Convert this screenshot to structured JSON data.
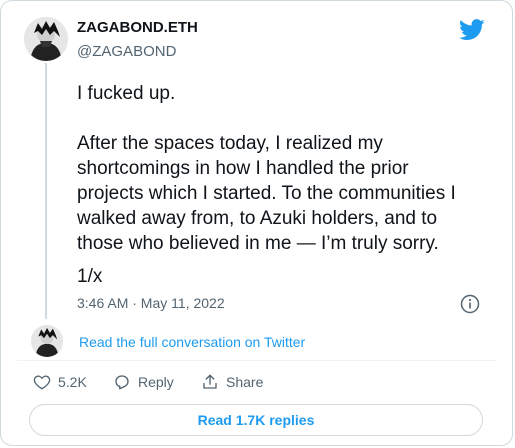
{
  "author": {
    "name": "ZAGABOND.ETH",
    "handle": "@ZAGABOND"
  },
  "tweet": {
    "line1": "I fucked up.",
    "line2": "After the spaces today, I realized my\nshortcomings in how I handled the prior\nprojects which I started. To the communities I\nwalked away from, to Azuki holders, and to\nthose who believed in me — I’m truly sorry.",
    "line3": "1/x",
    "timestamp": "3:46 AM · May 11, 2022"
  },
  "conversation_link": "Read the full conversation on Twitter",
  "actions": {
    "likes": "5.2K",
    "reply_label": "Reply",
    "share_label": "Share"
  },
  "replies_button": "Read 1.7K replies",
  "colors": {
    "accent": "#1d9bf0",
    "text": "#0f1419",
    "muted": "#536471",
    "border": "#cfd9de"
  },
  "icons": [
    "twitter-bird-icon",
    "info-icon",
    "heart-icon",
    "reply-icon",
    "share-icon"
  ]
}
